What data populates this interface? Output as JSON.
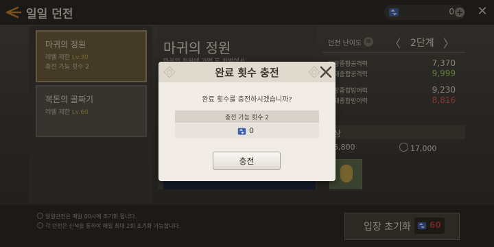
{
  "header": {
    "title": "일일 던전",
    "currency_value": "0",
    "currency_add": "+"
  },
  "dungeons": [
    {
      "name": "마귀의 정원",
      "level_label": "레벨 제한",
      "level": "Lv.30",
      "charge_text": "충전 가능 횟수 2",
      "selected": true
    },
    {
      "name": "복돈의 골짜기",
      "level_label": "레벨 제한",
      "level": "Lv.60",
      "selected": false
    }
  ],
  "center": {
    "title": "마귀의 정원",
    "description": "마귀의 정원에 가면 도 처벌에서 "
  },
  "difficulty": {
    "label": "던전 난이도",
    "value": "2단계",
    "prev": "〈",
    "next": "〉"
  },
  "stats": [
    {
      "label": "권장종합공격력",
      "value": "7,370",
      "tone": "white"
    },
    {
      "label": "현재종합공격력",
      "value": "9,999",
      "tone": "green"
    },
    {
      "label": "권장종합방어력",
      "value": "9,230",
      "tone": "white"
    },
    {
      "label": "현재종합방어력",
      "value": "8,816",
      "tone": "red"
    }
  ],
  "rewards": {
    "label": "상",
    "value_1": "6,800",
    "value_2": "17,000"
  },
  "notices": [
    "일일던전은 매일 00시에 초기화 됩니다.",
    "각 던전은 신석을 통하여 매일 최대 2회 초기화 가능합니다."
  ],
  "reset_button": {
    "label": "입장 초기화",
    "badge_value": "60"
  },
  "modal": {
    "title": "완료 횟수 충전",
    "question": "완료 횟수를 충전하시겠습니까?",
    "table_header": "충전 가능 횟수 2",
    "charge_value": "0",
    "confirm_label": "충전"
  },
  "colors": {
    "accent_gold": "#c9a94a",
    "stat_green": "#9bd35a",
    "stat_red": "#e05a4a",
    "modal_bg": "#f1ede6"
  }
}
